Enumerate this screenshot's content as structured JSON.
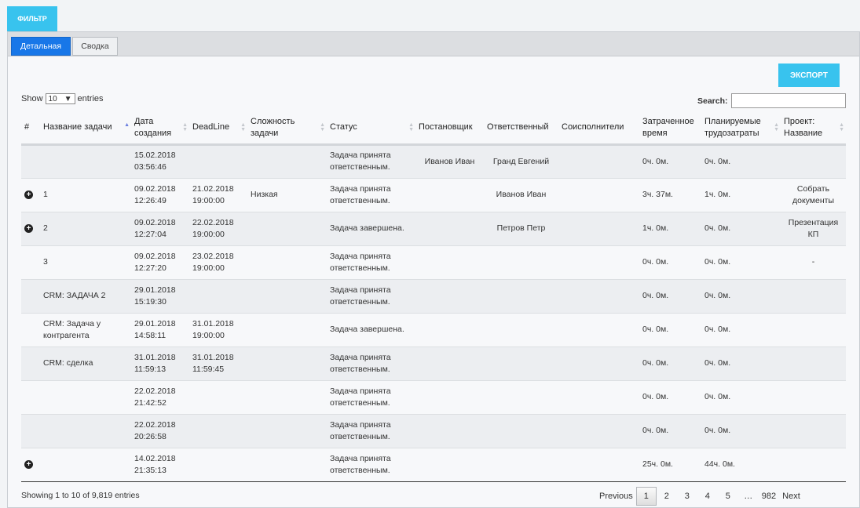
{
  "toolbar": {
    "filter_label": "ФИЛЬТР",
    "export_label": "ЭКСПОРТ"
  },
  "tabs": [
    {
      "label": "Детальная",
      "active": true
    },
    {
      "label": "Сводка",
      "active": false
    }
  ],
  "length_menu": {
    "show": "Show",
    "value": "10",
    "entries": "entries"
  },
  "search": {
    "label": "Search:",
    "value": ""
  },
  "columns": [
    "#",
    "Название задачи",
    "Дата создания",
    "DeadLine",
    "Сложность задачи",
    "Статус",
    "Постановщик",
    "Ответственный",
    "Соисполнители",
    "Затраченное время",
    "Планируемые трудозатраты",
    "Проект: Название"
  ],
  "rows": [
    {
      "expand": false,
      "name": "",
      "created": "15.02.2018\n03:56:46",
      "deadline": "",
      "difficulty": "",
      "status": "Задача принята\nответственным.",
      "author": "Иванов Иван",
      "responsible": "Гранд Евгений",
      "co": "",
      "spent": "0ч. 0м.",
      "planned": "0ч. 0м.",
      "project": ""
    },
    {
      "expand": true,
      "name": "1",
      "created": "09.02.2018\n12:26:49",
      "deadline": "21.02.2018\n19:00:00",
      "difficulty": "Низкая",
      "status": "Задача принята\nответственным.",
      "author": "",
      "responsible": "Иванов Иван",
      "co": "",
      "spent": "3ч. 37м.",
      "planned": "1ч. 0м.",
      "project": "Собрать\nдокументы"
    },
    {
      "expand": true,
      "name": "2",
      "created": "09.02.2018\n12:27:04",
      "deadline": "22.02.2018\n19:00:00",
      "difficulty": "",
      "status": "Задача завершена.",
      "author": "",
      "responsible": "Петров Петр",
      "co": "",
      "spent": "1ч. 0м.",
      "planned": "0ч. 0м.",
      "project": "Презентация\nКП"
    },
    {
      "expand": false,
      "name": "3",
      "created": "09.02.2018\n12:27:20",
      "deadline": "23.02.2018\n19:00:00",
      "difficulty": "",
      "status": "Задача принята\nответственным.",
      "author": "",
      "responsible": "",
      "co": "",
      "spent": "0ч. 0м.",
      "planned": "0ч. 0м.",
      "project": "-"
    },
    {
      "expand": false,
      "name": "CRM: ЗАДАЧА 2",
      "created": "29.01.2018\n15:19:30",
      "deadline": "",
      "difficulty": "",
      "status": "Задача принята\nответственным.",
      "author": "",
      "responsible": "",
      "co": "",
      "spent": "0ч. 0м.",
      "planned": "0ч. 0м.",
      "project": ""
    },
    {
      "expand": false,
      "name": "CRM: Задача у\nконтрагента",
      "created": "29.01.2018\n14:58:11",
      "deadline": "31.01.2018\n19:00:00",
      "difficulty": "",
      "status": "Задача завершена.",
      "author": "",
      "responsible": "",
      "co": "",
      "spent": "0ч. 0м.",
      "planned": "0ч. 0м.",
      "project": ""
    },
    {
      "expand": false,
      "name": "CRM: сделка",
      "created": "31.01.2018\n11:59:13",
      "deadline": "31.01.2018\n11:59:45",
      "difficulty": "",
      "status": "Задача принята\nответственным.",
      "author": "",
      "responsible": "",
      "co": "",
      "spent": "0ч. 0м.",
      "planned": "0ч. 0м.",
      "project": ""
    },
    {
      "expand": false,
      "name": "",
      "created": "22.02.2018\n21:42:52",
      "deadline": "",
      "difficulty": "",
      "status": "Задача принята\nответственным.",
      "author": "",
      "responsible": "",
      "co": "",
      "spent": "0ч. 0м.",
      "planned": "0ч. 0м.",
      "project": ""
    },
    {
      "expand": false,
      "name": "",
      "created": "22.02.2018\n20:26:58",
      "deadline": "",
      "difficulty": "",
      "status": "Задача принята\nответственным.",
      "author": "",
      "responsible": "",
      "co": "",
      "spent": "0ч. 0м.",
      "planned": "0ч. 0м.",
      "project": ""
    },
    {
      "expand": true,
      "name": "",
      "created": "14.02.2018\n21:35:13",
      "deadline": "",
      "difficulty": "",
      "status": "Задача принята\nответственным.",
      "author": "",
      "responsible": "",
      "co": "",
      "spent": "25ч. 0м.",
      "planned": "44ч. 0м.",
      "project": ""
    }
  ],
  "footer": {
    "info": "Showing 1 to 10 of 9,819 entries"
  },
  "pagination": {
    "previous": "Previous",
    "pages": [
      "1",
      "2",
      "3",
      "4",
      "5",
      "…",
      "982"
    ],
    "current": "1",
    "next": "Next"
  },
  "colors": {
    "accent": "#38c3ee",
    "active_tab": "#1877e8"
  },
  "icons": {
    "expand": "plus-circle-icon",
    "select": "chevron-down-icon"
  }
}
